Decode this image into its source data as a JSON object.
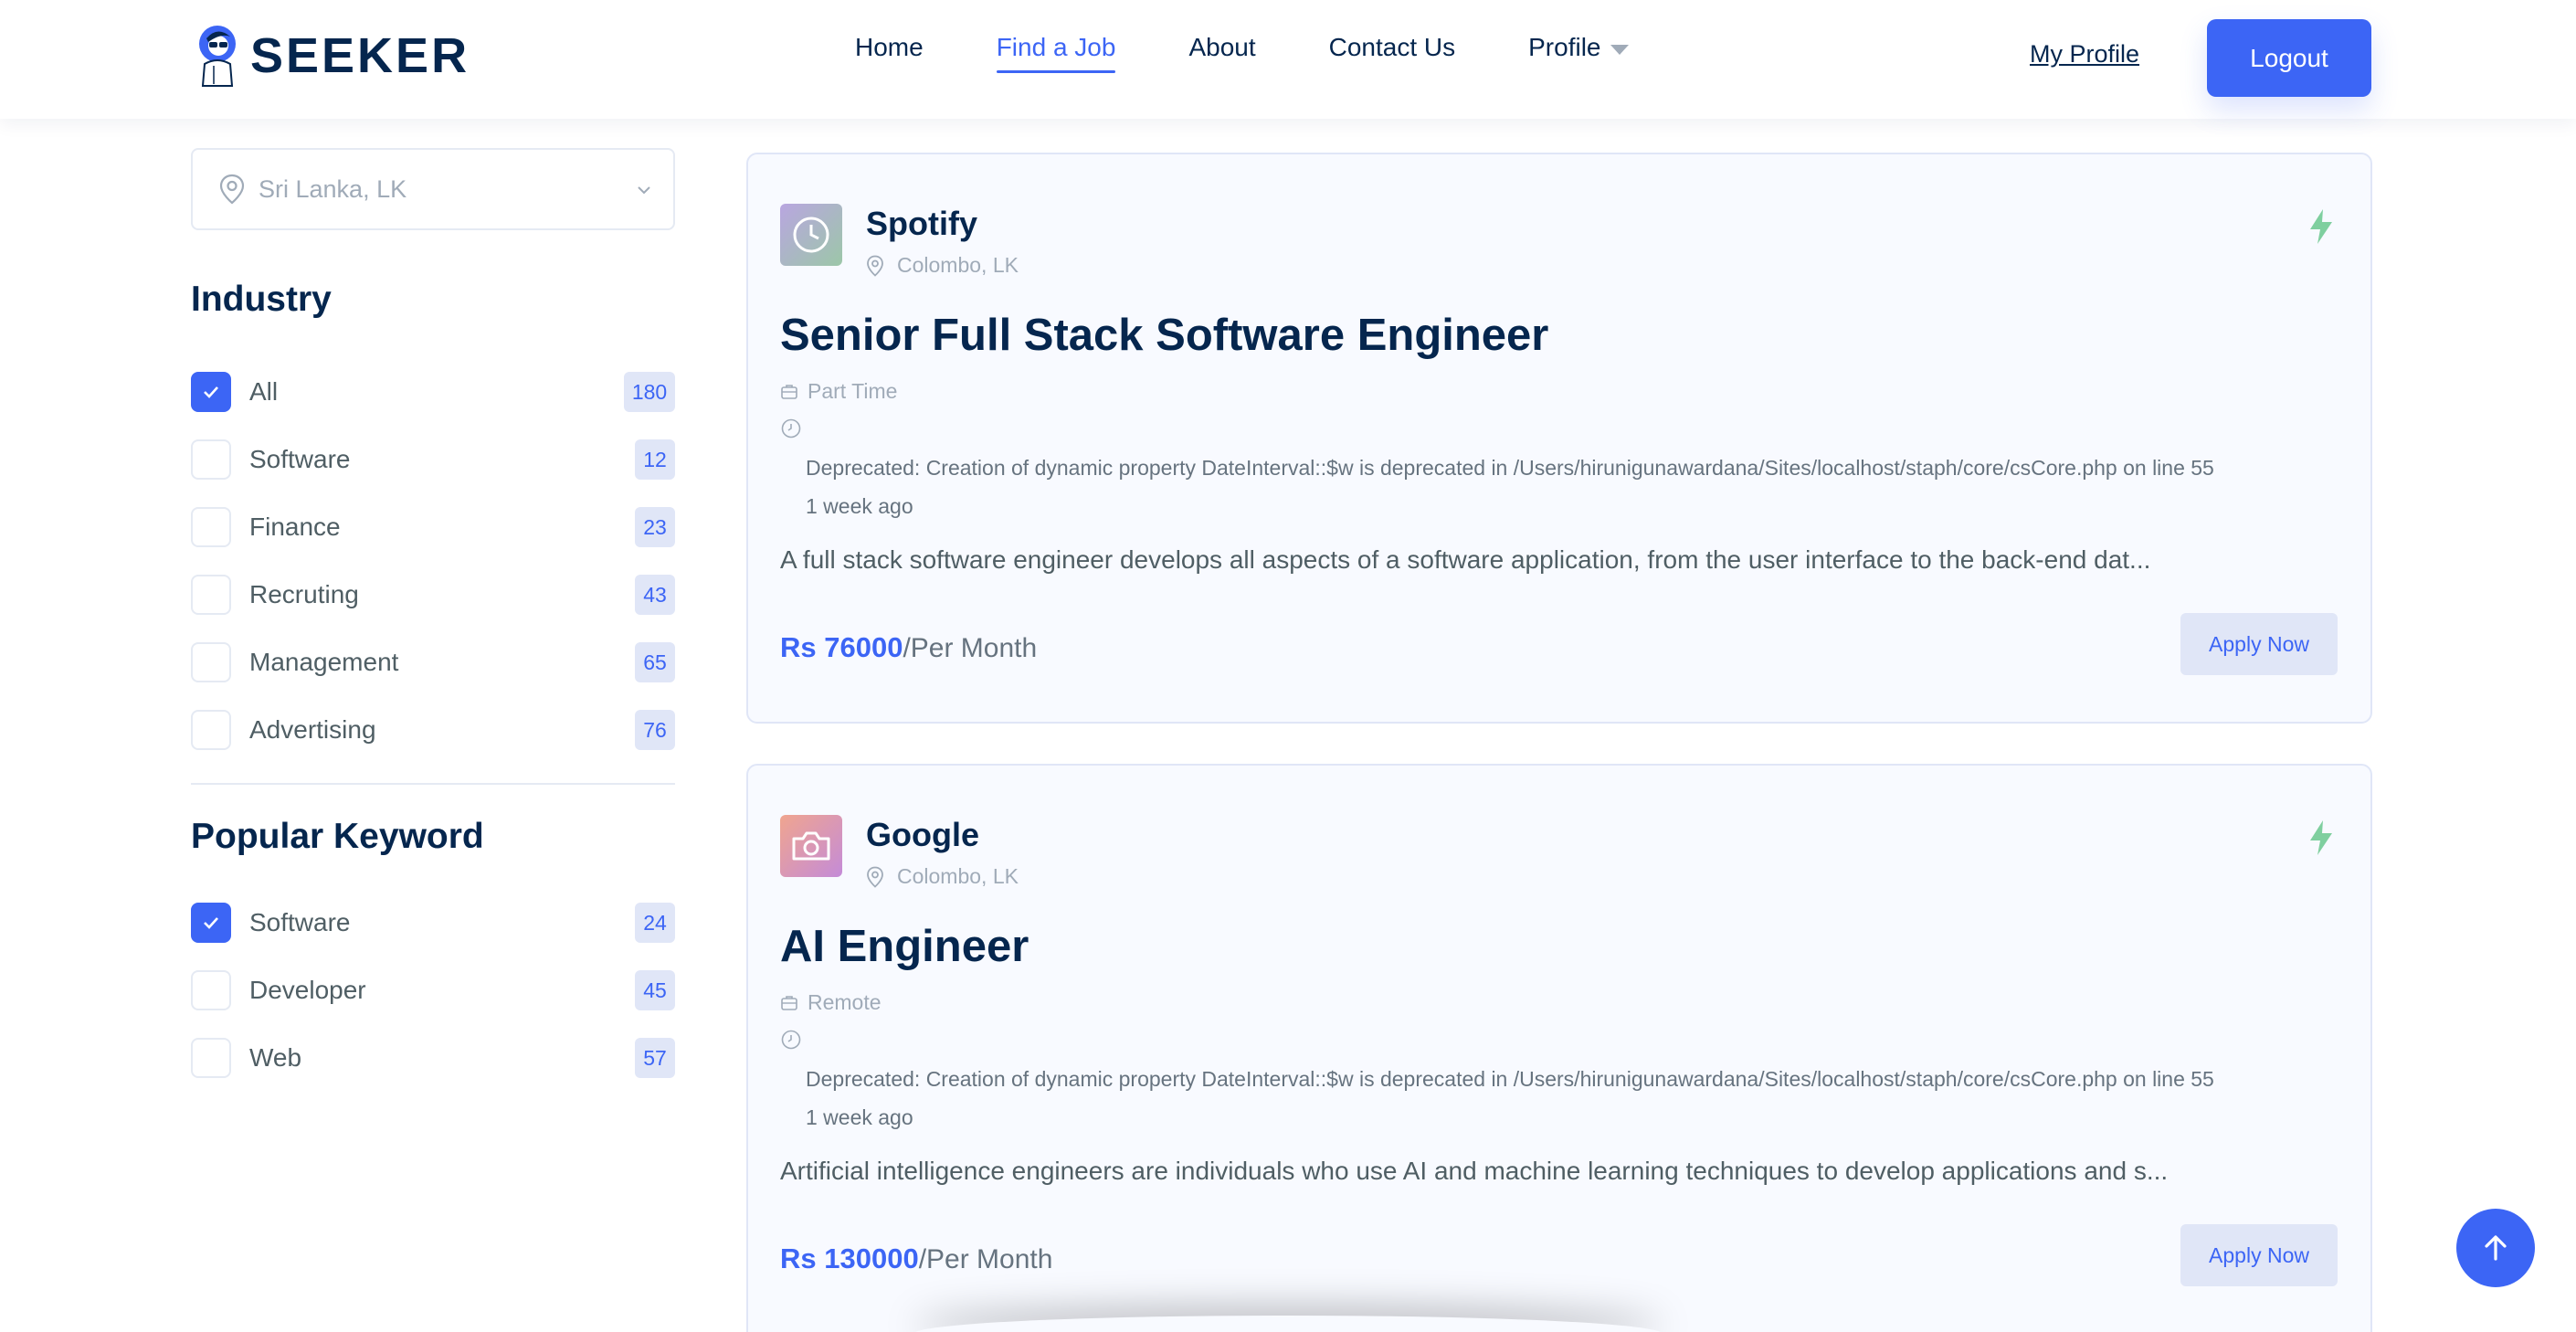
{
  "header": {
    "logo_text": "SEEKER",
    "nav": {
      "home": "Home",
      "find_job": "Find a Job",
      "about": "About",
      "contact": "Contact Us",
      "profile": "Profile"
    },
    "my_profile": "My Profile",
    "logout": "Logout"
  },
  "sidebar": {
    "location": "Sri Lanka, LK",
    "industry_title": "Industry",
    "industries": [
      {
        "label": "All",
        "count": "180",
        "checked": true
      },
      {
        "label": "Software",
        "count": "12",
        "checked": false
      },
      {
        "label": "Finance",
        "count": "23",
        "checked": false
      },
      {
        "label": "Recruting",
        "count": "43",
        "checked": false
      },
      {
        "label": "Management",
        "count": "65",
        "checked": false
      },
      {
        "label": "Advertising",
        "count": "76",
        "checked": false
      }
    ],
    "keyword_title": "Popular Keyword",
    "keywords": [
      {
        "label": "Software",
        "count": "24",
        "checked": true
      },
      {
        "label": "Developer",
        "count": "45",
        "checked": false
      },
      {
        "label": "Web",
        "count": "57",
        "checked": false
      }
    ]
  },
  "jobs": [
    {
      "company": "Spotify",
      "location": "Colombo, LK",
      "title": "Senior Full Stack Software Engineer",
      "type": "Part Time",
      "notice": "Deprecated: Creation of dynamic property DateInterval::$w is deprecated in /Users/hirunigunawardana/Sites/localhost/staph/core/csCore.php on line 55",
      "posted": "1 week ago",
      "description": "A full stack software engineer develops all aspects of a software application, from the user interface to the back-end dat...",
      "salary_amount": "Rs 76000",
      "salary_period": "/Per Month",
      "apply": "Apply Now",
      "logo_icon": "clock-icon"
    },
    {
      "company": "Google",
      "location": "Colombo, LK",
      "title": "AI Engineer",
      "type": "Remote",
      "notice": "Deprecated: Creation of dynamic property DateInterval::$w is deprecated in /Users/hirunigunawardana/Sites/localhost/staph/core/csCore.php on line 55",
      "posted": "1 week ago",
      "description": "Artificial intelligence engineers are individuals who use AI and machine learning techniques to develop applications and s...",
      "salary_amount": "Rs 130000",
      "salary_period": "/Per Month",
      "apply": "Apply Now",
      "logo_icon": "camera-icon"
    }
  ],
  "colors": {
    "accent": "#3c65f5",
    "heading": "#05264e",
    "muted": "#a0abb8",
    "flash": "#7fcf9f"
  }
}
